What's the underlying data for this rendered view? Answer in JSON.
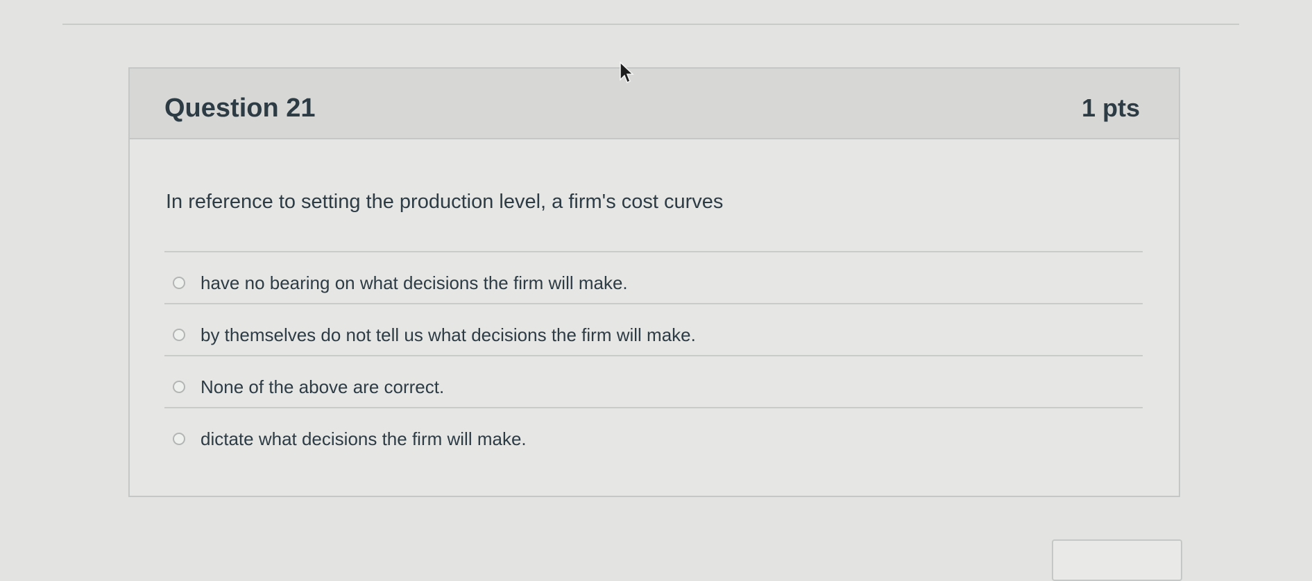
{
  "question": {
    "title": "Question 21",
    "points": "1 pts",
    "text": "In reference to setting the production level, a firm's cost curves",
    "answers": [
      {
        "label": "have no bearing on what decisions the firm will make."
      },
      {
        "label": "by themselves do not tell us what decisions the firm will make."
      },
      {
        "label": "None of the above are correct."
      },
      {
        "label": "dictate what decisions the firm will make."
      }
    ]
  },
  "navigation": {
    "next_label": ""
  },
  "icons": {
    "cursor": "arrow-cursor-icon",
    "radio": "radio-button-icon"
  }
}
